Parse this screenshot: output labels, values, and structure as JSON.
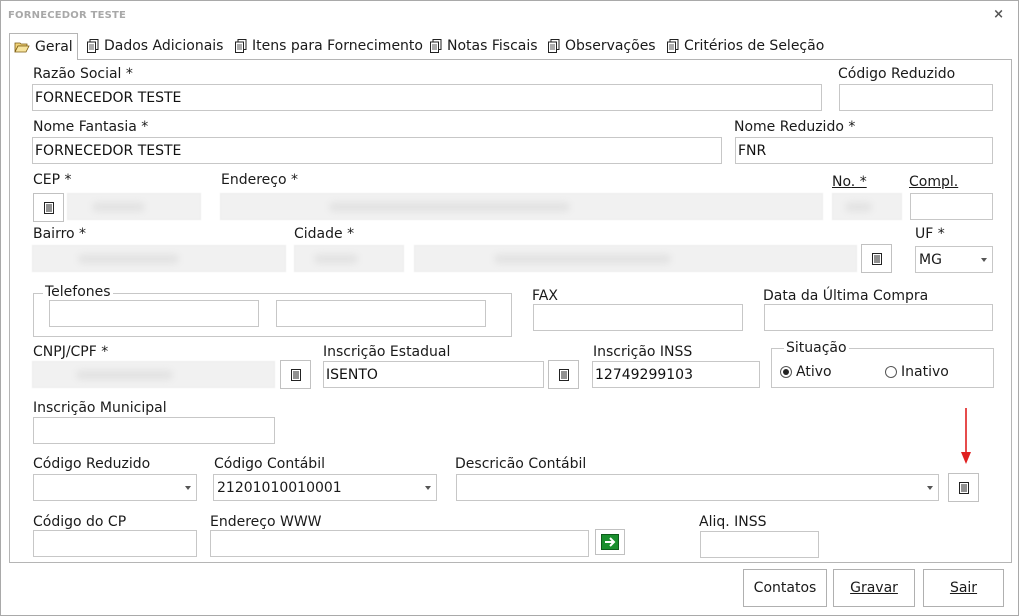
{
  "window": {
    "title": "FORNECEDOR TESTE",
    "close_glyph": "×"
  },
  "tabs": [
    {
      "label": "Geral",
      "icon": "folder-open-icon"
    },
    {
      "label": "Dados Adicionais",
      "icon": "document-copy-icon"
    },
    {
      "label": "Itens para Fornecimento",
      "icon": "document-copy-icon"
    },
    {
      "label": "Notas Fiscais",
      "icon": "document-copy-icon"
    },
    {
      "label": "Observações",
      "icon": "document-copy-icon"
    },
    {
      "label": "Critérios de Seleção",
      "icon": "document-copy-icon"
    }
  ],
  "form": {
    "razao_social": {
      "label": "Razão Social *",
      "value": "FORNECEDOR TESTE"
    },
    "codigo_reduzido_top": {
      "label": "Código Reduzido",
      "value": ""
    },
    "nome_fantasia": {
      "label": "Nome Fantasia *",
      "value": "FORNECEDOR TESTE"
    },
    "nome_reduzido": {
      "label": "Nome Reduzido *",
      "value": "FNR"
    },
    "cep": {
      "label": "CEP *"
    },
    "endereco": {
      "label": "Endereço *"
    },
    "numero": {
      "label": "No. *"
    },
    "compl": {
      "label": "Compl.",
      "value": ""
    },
    "bairro": {
      "label": "Bairro *"
    },
    "cidade": {
      "label": "Cidade *"
    },
    "uf": {
      "label": "UF *",
      "value": "MG"
    },
    "telefones": {
      "label": "Telefones",
      "value1": "",
      "value2": ""
    },
    "fax": {
      "label": "FAX",
      "value": ""
    },
    "data_ultima_compra": {
      "label": "Data da Última Compra",
      "value": ""
    },
    "cnpj_cpf": {
      "label": "CNPJ/CPF *"
    },
    "inscricao_estadual": {
      "label": "Inscrição Estadual",
      "value": "ISENTO"
    },
    "inscricao_inss": {
      "label": "Inscrição INSS",
      "value": "12749299103"
    },
    "situacao": {
      "label": "Situação",
      "option_ativo": "Ativo",
      "option_inativo": "Inativo",
      "selected": "Ativo"
    },
    "inscricao_municipal": {
      "label": "Inscrição Municipal",
      "value": ""
    },
    "codigo_reduzido": {
      "label": "Código Reduzido",
      "value": ""
    },
    "codigo_contabil": {
      "label": "Código Contábil",
      "value": "21201010010001"
    },
    "descricao_contabil": {
      "label": "Descricão Contábil",
      "value": ""
    },
    "codigo_cp": {
      "label": "Código do CP",
      "value": ""
    },
    "endereco_www": {
      "label": "Endereço WWW",
      "value": ""
    },
    "aliq_inss": {
      "label": "Aliq. INSS",
      "value": ""
    }
  },
  "buttons": {
    "contatos": "Contatos",
    "gravar": "Gravar",
    "sair": "Sair"
  },
  "colors": {
    "annotation_arrow": "#e02020",
    "go_button": "#1a8f2e"
  }
}
